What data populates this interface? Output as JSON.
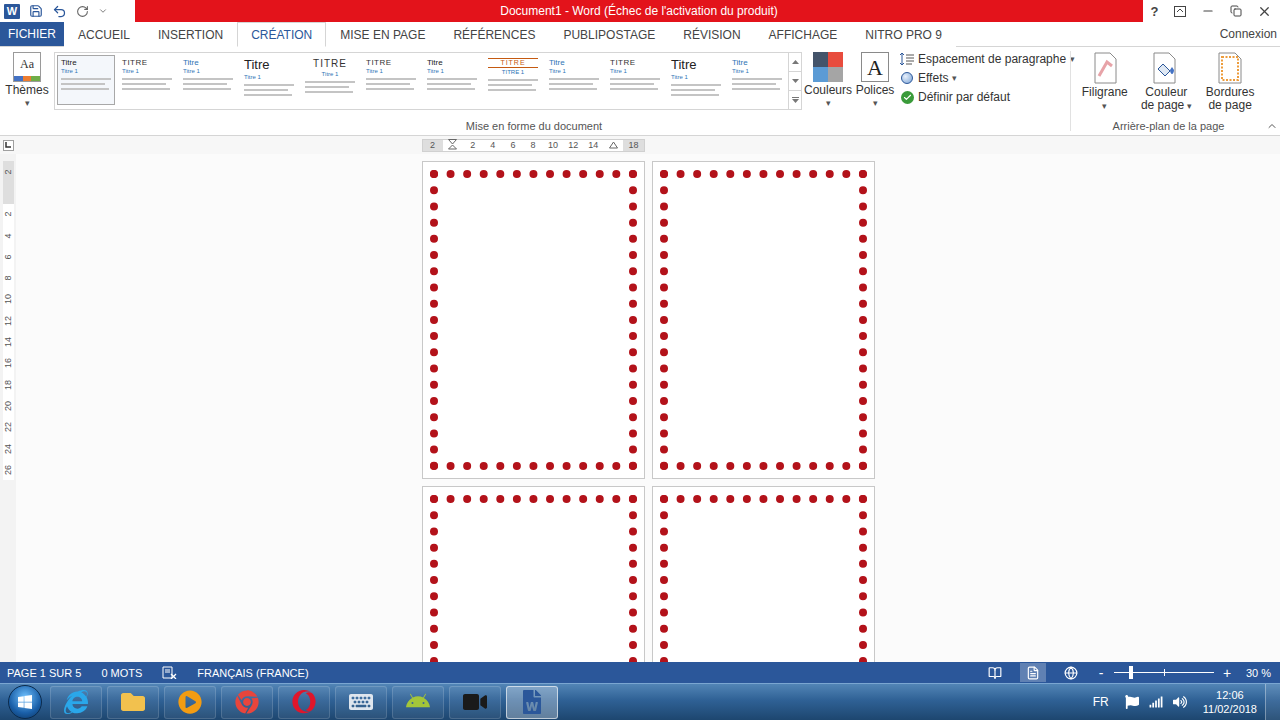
{
  "window": {
    "logo": "W",
    "title": "Document1 - Word (Échec de l'activation du produit)",
    "help": "?"
  },
  "tabs": [
    {
      "label": "FICHIER",
      "kind": "file",
      "selected": false
    },
    {
      "label": "ACCUEIL",
      "kind": "tab",
      "selected": false
    },
    {
      "label": "INSERTION",
      "kind": "tab",
      "selected": false
    },
    {
      "label": "CRÉATION",
      "kind": "tab",
      "selected": true
    },
    {
      "label": "MISE EN PAGE",
      "kind": "tab",
      "selected": false
    },
    {
      "label": "RÉFÉRENCES",
      "kind": "tab",
      "selected": false
    },
    {
      "label": "PUBLIPOSTAGE",
      "kind": "tab",
      "selected": false
    },
    {
      "label": "RÉVISION",
      "kind": "tab",
      "selected": false
    },
    {
      "label": "AFFICHAGE",
      "kind": "tab",
      "selected": false
    },
    {
      "label": "NITRO PRO 9",
      "kind": "tab",
      "selected": false
    }
  ],
  "account": "Connexion",
  "ribbon": {
    "dropdown_glyph": "▾",
    "themes": {
      "label": "Thèmes",
      "icon_text": "Aa",
      "dropdown": true
    },
    "gallery": [
      {
        "title": "Titre",
        "heading": "Titre 1",
        "kind": "plain",
        "selected": true
      },
      {
        "title": "TITRE",
        "heading": "Titre 1",
        "kind": "caps",
        "selected": false
      },
      {
        "title": "Titre",
        "heading": "Titre 1",
        "kind": "accent",
        "selected": false
      },
      {
        "title": "Titre",
        "heading": "Titre 1",
        "kind": "large",
        "selected": false
      },
      {
        "title": "TITRE",
        "heading": "Titre 1",
        "kind": "centered",
        "selected": false
      },
      {
        "title": "TITRE",
        "heading": "Titre 1",
        "kind": "caps",
        "selected": false
      },
      {
        "title": "Titre",
        "heading": "Titre 1",
        "kind": "plain",
        "selected": false
      },
      {
        "title": "TITRE",
        "heading": "TITRE 1",
        "kind": "boxed",
        "selected": false
      },
      {
        "title": "Titre",
        "heading": "Titre 1",
        "kind": "accent",
        "selected": false
      },
      {
        "title": "TITRE",
        "heading": "Titre 1",
        "kind": "caps",
        "selected": false
      },
      {
        "title": "Titre",
        "heading": "Titre 1",
        "kind": "large",
        "selected": false
      },
      {
        "title": "Titre",
        "heading": "Titre 1",
        "kind": "accent",
        "selected": false
      }
    ],
    "colors": {
      "label": "Couleurs",
      "dropdown": true
    },
    "fonts": {
      "label": "Polices",
      "icon_text": "A",
      "dropdown": true
    },
    "options": [
      {
        "label": "Espacement de paragraphe",
        "kind": "spacing",
        "dropdown": true
      },
      {
        "label": "Effets",
        "kind": "effects",
        "dropdown": true
      },
      {
        "label": "Définir par défaut",
        "kind": "default",
        "dropdown": false
      }
    ],
    "format_group": "Mise en forme du document",
    "background_buttons": [
      {
        "label": "Filigrane",
        "kind": "watermark",
        "dropdown": true
      },
      {
        "label": "Couleur de page",
        "kind": "page-color",
        "dropdown": true
      },
      {
        "label": "Bordures de page",
        "kind": "page-borders",
        "dropdown": false
      }
    ],
    "background_group": "Arrière-plan de la page"
  },
  "ruler": {
    "horizontal": [
      {
        "label": "2",
        "kind": "margin"
      },
      {
        "kind": "indent"
      },
      {
        "label": "2",
        "kind": "number"
      },
      {
        "label": "4",
        "kind": "number"
      },
      {
        "label": "6",
        "kind": "number"
      },
      {
        "label": "8",
        "kind": "number"
      },
      {
        "label": "10",
        "kind": "number"
      },
      {
        "label": "12",
        "kind": "number"
      },
      {
        "label": "14",
        "kind": "number"
      },
      {
        "kind": "right-indent"
      },
      {
        "label": "18",
        "kind": "margin"
      }
    ],
    "vertical": [
      {
        "label": "2",
        "kind": "margin"
      },
      {
        "kind": "gap"
      },
      {
        "label": "2",
        "kind": "number"
      },
      {
        "label": "4",
        "kind": "number"
      },
      {
        "label": "6",
        "kind": "number"
      },
      {
        "label": "8",
        "kind": "number"
      },
      {
        "label": "10",
        "kind": "number"
      },
      {
        "label": "12",
        "kind": "number"
      },
      {
        "label": "14",
        "kind": "number"
      },
      {
        "label": "16",
        "kind": "number"
      },
      {
        "label": "18",
        "kind": "number"
      },
      {
        "label": "20",
        "kind": "number"
      },
      {
        "label": "22",
        "kind": "number"
      },
      {
        "label": "24",
        "kind": "number"
      },
      {
        "label": "26",
        "kind": "number"
      }
    ]
  },
  "document": {
    "pages": [
      {
        "bordered": true
      },
      {
        "bordered": true
      },
      {
        "bordered": true
      },
      {
        "bordered": true
      }
    ]
  },
  "status_bar": {
    "page": "PAGE 1 SUR 5",
    "words": "0 MOTS",
    "language": "FRANÇAIS (FRANCE)",
    "views": [
      {
        "kind": "read",
        "selected": false
      },
      {
        "kind": "print",
        "selected": true
      },
      {
        "kind": "web",
        "selected": false
      }
    ],
    "zoom": {
      "minus": "-",
      "plus": "+",
      "level": 0.17,
      "reading": "30 %"
    }
  },
  "taskbar": {
    "apps": [
      {
        "kind": "internet-explorer",
        "active": false
      },
      {
        "kind": "explorer",
        "active": false
      },
      {
        "kind": "media-player",
        "active": false
      },
      {
        "kind": "chrome",
        "active": false
      },
      {
        "kind": "opera",
        "active": false
      },
      {
        "kind": "remote",
        "active": false
      },
      {
        "kind": "android",
        "active": false
      },
      {
        "kind": "camera",
        "active": false
      },
      {
        "kind": "word",
        "active": true
      }
    ],
    "language": "FR",
    "tray": [
      {
        "kind": "flag"
      },
      {
        "kind": "network"
      },
      {
        "kind": "volume"
      }
    ],
    "time": "12:06",
    "date": "11/02/2018"
  }
}
